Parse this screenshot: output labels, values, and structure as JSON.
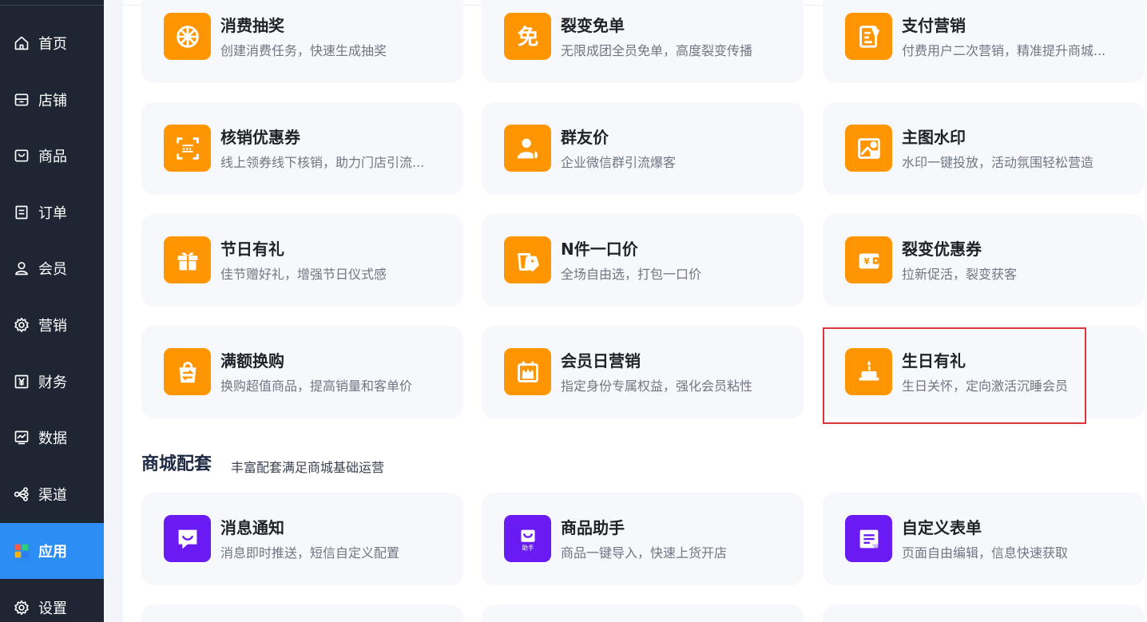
{
  "colors": {
    "sidebar_bg": "#1e2634",
    "active_bg": "#2b8cf3",
    "orange": "#ff9500",
    "purple": "#6a1af2",
    "highlight": "#d9363e"
  },
  "sidebar": {
    "items": [
      {
        "label": "首页",
        "icon": "home-icon"
      },
      {
        "label": "店铺",
        "icon": "store-icon"
      },
      {
        "label": "商品",
        "icon": "bag-icon"
      },
      {
        "label": "订单",
        "icon": "order-icon"
      },
      {
        "label": "会员",
        "icon": "user-icon"
      },
      {
        "label": "营销",
        "icon": "gear-icon"
      },
      {
        "label": "财务",
        "icon": "yuan-icon"
      },
      {
        "label": "数据",
        "icon": "chart-icon"
      },
      {
        "label": "渠道",
        "icon": "share-icon"
      },
      {
        "label": "应用",
        "icon": "grid-icon",
        "active": true
      },
      {
        "label": "设置",
        "icon": "settings-icon"
      }
    ]
  },
  "marketing_apps": [
    {
      "title": "消费抽奖",
      "desc": "创建消费任务，快速生成抽奖",
      "icon": "wheel-icon"
    },
    {
      "title": "裂变免单",
      "desc": "无限成团全员免单，高度裂变传播",
      "icon": "free-icon"
    },
    {
      "title": "支付营销",
      "desc": "付费用户二次营销，精准提升商城...",
      "icon": "payment-icon"
    },
    {
      "title": "核销优惠券",
      "desc": "线上领券线下核销，助力门店引流...",
      "icon": "scan-coupon-icon"
    },
    {
      "title": "群友价",
      "desc": "企业微信群引流爆客",
      "icon": "group-price-icon"
    },
    {
      "title": "主图水印",
      "desc": "水印一键投放，活动氛围轻松营造",
      "icon": "watermark-icon"
    },
    {
      "title": "节日有礼",
      "desc": "佳节赠好礼，增强节日仪式感",
      "icon": "gift-icon"
    },
    {
      "title": "N件一口价",
      "desc": "全场自由选，打包一口价",
      "icon": "price-tag-icon"
    },
    {
      "title": "裂变优惠券",
      "desc": "拉新促活，裂变获客",
      "icon": "wallet-coupon-icon"
    },
    {
      "title": "满额换购",
      "desc": "换购超值商品，提高销量和客单价",
      "icon": "exchange-bag-icon"
    },
    {
      "title": "会员日营销",
      "desc": "指定身份专属权益，强化会员粘性",
      "icon": "calendar-crown-icon"
    },
    {
      "title": "生日有礼",
      "desc": "生日关怀，定向激活沉睡会员",
      "icon": "cake-icon"
    }
  ],
  "mall_section": {
    "title": "商城配套",
    "subtitle": "丰富配套满足商城基础运营",
    "apps": [
      {
        "title": "消息通知",
        "desc": "消息即时推送，短信自定义配置",
        "icon": "message-icon"
      },
      {
        "title": "商品助手",
        "desc": "商品一键导入，快速上货开店",
        "icon": "product-helper-icon",
        "badge": "助手"
      },
      {
        "title": "自定义表单",
        "desc": "页面自由编辑，信息快速获取",
        "icon": "form-icon"
      }
    ]
  }
}
